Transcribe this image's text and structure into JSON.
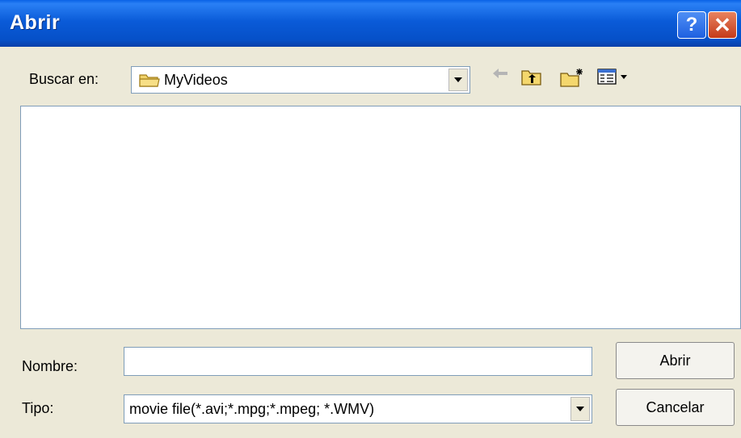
{
  "window": {
    "title": "Abrir"
  },
  "look_in": {
    "label": "Buscar en:",
    "folder": "MyVideos"
  },
  "filename": {
    "label": "Nombre:",
    "value": ""
  },
  "filetype": {
    "label": "Tipo:",
    "value": "movie file(*.avi;*.mpg;*.mpeg; *.WMV)"
  },
  "buttons": {
    "open": "Abrir",
    "cancel": "Cancelar"
  },
  "icons": {
    "back": "back-arrow-icon",
    "up": "up-folder-icon",
    "new_folder": "new-folder-icon",
    "view": "view-menu-icon",
    "folder": "folder-icon"
  }
}
